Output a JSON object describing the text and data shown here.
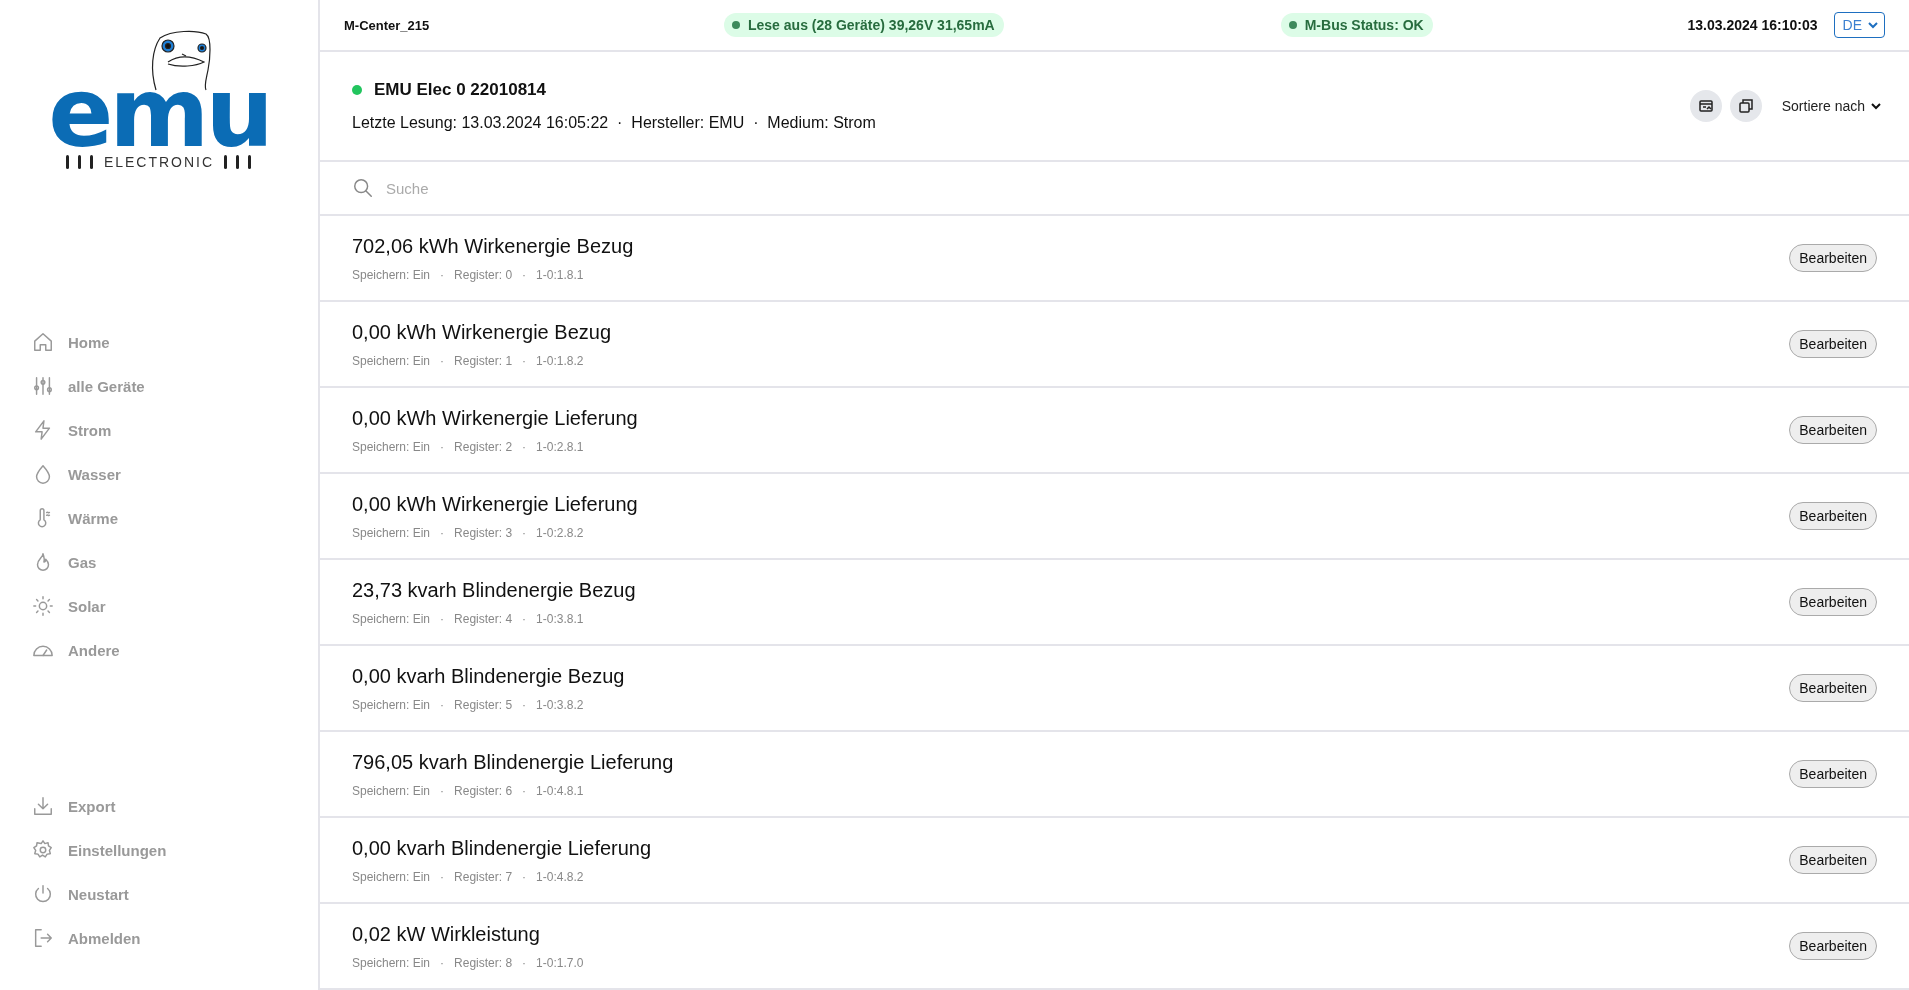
{
  "logo": {
    "wordmark": "emu",
    "tagline": "ELECTRONIC"
  },
  "sidebar": {
    "items": [
      {
        "label": "Home",
        "selected": false
      },
      {
        "label": "alle Geräte",
        "selected": false
      },
      {
        "label": "Strom",
        "selected": false
      },
      {
        "label": "Wasser",
        "selected": false
      },
      {
        "label": "Wärme",
        "selected": false
      },
      {
        "label": "Gas",
        "selected": false
      },
      {
        "label": "Solar",
        "selected": false
      },
      {
        "label": "Andere",
        "selected": false
      }
    ],
    "bottom_items": [
      {
        "label": "Export"
      },
      {
        "label": "Einstellungen"
      },
      {
        "label": "Neustart"
      },
      {
        "label": "Abmelden"
      }
    ]
  },
  "top_bar": {
    "device": "M-Center_215",
    "status_pills": [
      {
        "text": "Lese aus (28 Geräte) 39,26V 31,65mA"
      },
      {
        "text": "M-Bus Status: OK"
      }
    ],
    "datetime": "13.03.2024 16:10:03",
    "language": "DE"
  },
  "meter": {
    "name": "EMU Elec 0 22010814",
    "online": true,
    "info": "Letzte Lesung: 13.03.2024 16:05:22  ·  Hersteller: EMU  ·  Medium: Strom",
    "sort_label": "Sortiere nach"
  },
  "search": {
    "placeholder": "Suche"
  },
  "registers": [
    {
      "title": "702,06 kWh Wirkenergie Bezug",
      "meta": "Speichern: Ein   ·   Register: 0   ·   1-0:1.8.1",
      "button": "Bearbeiten"
    },
    {
      "title": "0,00 kWh Wirkenergie Bezug",
      "meta": "Speichern: Ein   ·   Register: 1   ·   1-0:1.8.2",
      "button": "Bearbeiten"
    },
    {
      "title": "0,00 kWh Wirkenergie Lieferung",
      "meta": "Speichern: Ein   ·   Register: 2   ·   1-0:2.8.1",
      "button": "Bearbeiten"
    },
    {
      "title": "0,00 kWh Wirkenergie Lieferung",
      "meta": "Speichern: Ein   ·   Register: 3   ·   1-0:2.8.2",
      "button": "Bearbeiten"
    },
    {
      "title": "23,73 kvarh Blindenergie Bezug",
      "meta": "Speichern: Ein   ·   Register: 4   ·   1-0:3.8.1",
      "button": "Bearbeiten"
    },
    {
      "title": "0,00 kvarh Blindenergie Bezug",
      "meta": "Speichern: Ein   ·   Register: 5   ·   1-0:3.8.2",
      "button": "Bearbeiten"
    },
    {
      "title": "796,05 kvarh Blindenergie Lieferung",
      "meta": "Speichern: Ein   ·   Register: 6   ·   1-0:4.8.1",
      "button": "Bearbeiten"
    },
    {
      "title": "0,00 kvarh Blindenergie Lieferung",
      "meta": "Speichern: Ein   ·   Register: 7   ·   1-0:4.8.2",
      "button": "Bearbeiten"
    },
    {
      "title": "0,02 kW Wirkleistung",
      "meta": "Speichern: Ein   ·   Register: 8   ·   1-0:1.7.0",
      "button": "Bearbeiten"
    }
  ]
}
